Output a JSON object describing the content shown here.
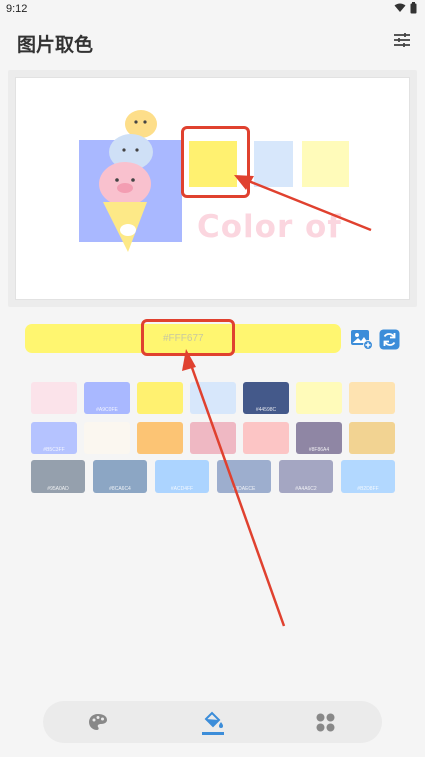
{
  "status_bar": {
    "time": "9:12"
  },
  "header": {
    "title": "图片取色"
  },
  "preview": {
    "artwork_text": "Color of"
  },
  "picked": {
    "hex": "#FFF677",
    "color": "#fff670"
  },
  "palette": [
    {
      "color": "#fbe3ea",
      "label": ""
    },
    {
      "color": "#a9b8ff",
      "label": "#A9C0FE"
    },
    {
      "color": "#fff170",
      "label": ""
    },
    {
      "color": "#d7e7fb",
      "label": ""
    },
    {
      "color": "#44598a",
      "label": "#44598C"
    },
    {
      "color": "#fffbba",
      "label": ""
    },
    {
      "color": "#fee3b1",
      "label": ""
    },
    {
      "color": "#b5c3ff",
      "label": "#B5C3FF"
    },
    {
      "color": "#fbf7f0",
      "label": ""
    },
    {
      "color": "#fcc474",
      "label": ""
    },
    {
      "color": "#efb8c3",
      "label": ""
    },
    {
      "color": "#fcc5c5",
      "label": ""
    },
    {
      "color": "#8f86a4",
      "label": "#8F86A4"
    },
    {
      "color": "#f2d392",
      "label": ""
    },
    {
      "color": "#95a0ad",
      "label": "#95A0AD"
    },
    {
      "color": "#8ca6c4",
      "label": "#8CA6C4"
    },
    {
      "color": "#acd4ff",
      "label": "#ACD4FF"
    },
    {
      "color": "#9daece",
      "label": "#9DAECE"
    },
    {
      "color": "#a4a6c2",
      "label": "#A4A6C2"
    },
    {
      "color": "#b2d8ff",
      "label": "#B2D8FF"
    }
  ],
  "accent_red": "#e0412f",
  "accent_blue": "#3c8dd9"
}
